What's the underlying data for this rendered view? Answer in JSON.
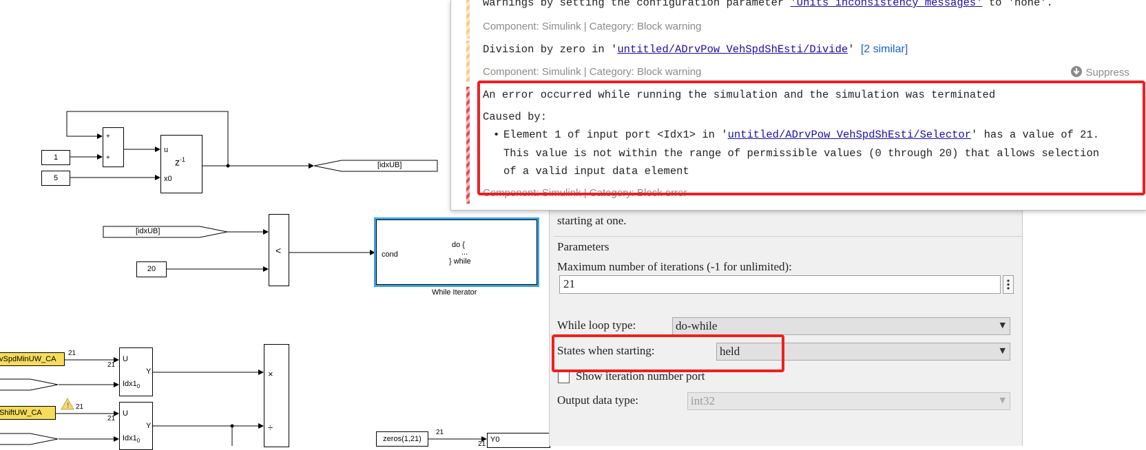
{
  "diagram": {
    "const_1": "1",
    "const_5": "5",
    "const_20": "20",
    "plus_top": "+",
    "plus_bottom": "+",
    "delay_u": "u",
    "delay_x0": "x0",
    "delay_z": "z",
    "delay_exp": "-1",
    "goto_idxub": "[idxUB]",
    "from_idxub": "[idxUB]",
    "relop": "<",
    "while_cond": "cond",
    "while_do": "do {",
    "while_dots": "...",
    "while_end": "} while",
    "while_name": "While Iterator",
    "sel1_input": "vSpdMinUW_CA",
    "sel2_input": "ShiftUW_CA",
    "sel1_u": "U",
    "sel1_y": "Y",
    "sel1_idx": "Idx1",
    "sel1_idx_sub": "0",
    "sel2_u": "U",
    "sel2_y": "Y",
    "sel2_idx": "Idx1",
    "sel2_idx_sub": "0",
    "sig21_a": "21",
    "sig21_b": "21",
    "sig21_c": "21",
    "sig21_d": "21",
    "sig21_e": "21",
    "sig21_f": "21",
    "product_mul": "×",
    "product_div": "÷",
    "zeros_block": "zeros(1,21)",
    "y0_label": "Y0"
  },
  "diagnostics": {
    "warning1_text": "warnings by setting the configuration parameter ",
    "warning1_link": "'Units inconsistency messages'",
    "warning1_tail": " to 'none'.",
    "warning1_meta": "Component: Simulink | Category: Block warning",
    "warning2_prefix": "Division by zero in '",
    "warning2_link": "untitled/ADrvPow_VehSpdShEsti/Divide",
    "warning2_suffix": "'",
    "warning2_similar": "[2 similar]",
    "warning2_meta": "Component: Simulink | Category: Block warning",
    "suppress_label": "Suppress",
    "error_title": "An error occurred while running the simulation and the simulation was terminated",
    "error_caused": "Caused by:",
    "error_bullet_prefix": "Element 1 of input port <Idx1> in '",
    "error_bullet_link": "untitled/ADrvPow_VehSpdShEsti/Selector",
    "error_bullet_suffix": "' has a value of 21.",
    "error_line2": "This value is not within the range of permissible values (0 through 20) that allows selection",
    "error_line3": "of a valid input data element",
    "error_meta": "Component: Simulink | Category: Block error"
  },
  "params": {
    "partial_text": "starting at one.",
    "group_title": "Parameters",
    "max_iter_label": "Maximum number of iterations (-1 for unlimited):",
    "max_iter_value": "21",
    "loop_type_label": "While loop type:",
    "loop_type_value": "do-while",
    "states_label": "States when starting:",
    "states_value": "held",
    "show_iter_label": "Show iteration number port",
    "output_type_label": "Output data type:",
    "output_type_value": "int32"
  },
  "colors": {
    "highlight_red": "#ef1f1f",
    "block_selected": "#3aa3e3",
    "goto_yellow": "#f5dc5a",
    "link_blue": "#1a0dab"
  }
}
